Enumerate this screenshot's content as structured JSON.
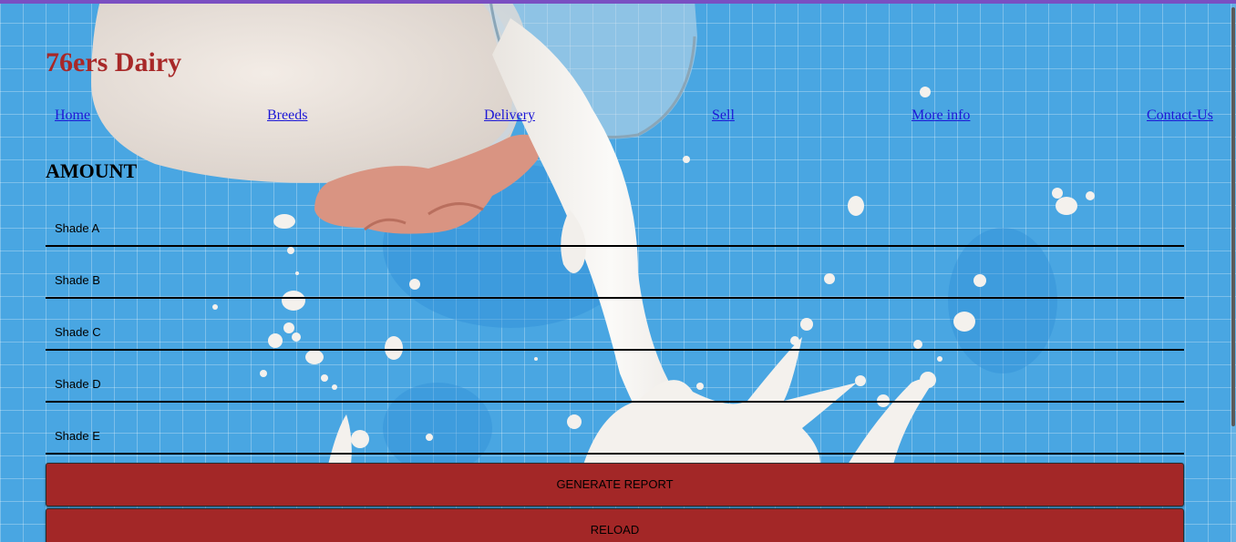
{
  "site": {
    "title": "76ers Dairy"
  },
  "nav": {
    "items": [
      {
        "label": "Home"
      },
      {
        "label": "Breeds"
      },
      {
        "label": "Delivery"
      },
      {
        "label": "Sell"
      },
      {
        "label": "More info"
      },
      {
        "label": "Contact-Us"
      }
    ]
  },
  "form": {
    "heading": "AMOUNT",
    "fields": [
      {
        "placeholder": "Shade A",
        "value": ""
      },
      {
        "placeholder": "Shade B",
        "value": ""
      },
      {
        "placeholder": "Shade C",
        "value": ""
      },
      {
        "placeholder": "Shade D",
        "value": ""
      },
      {
        "placeholder": "Shade E",
        "value": ""
      }
    ],
    "generate_label": "GENERATE REPORT",
    "reload_label": "RELOAD"
  },
  "colors": {
    "background": "#49a6e2",
    "title": "#a82828",
    "link": "#1d18d6",
    "button": "#a32727",
    "top_bar": "#7a4fc2"
  },
  "hero_image": "milk-pouring-splash"
}
